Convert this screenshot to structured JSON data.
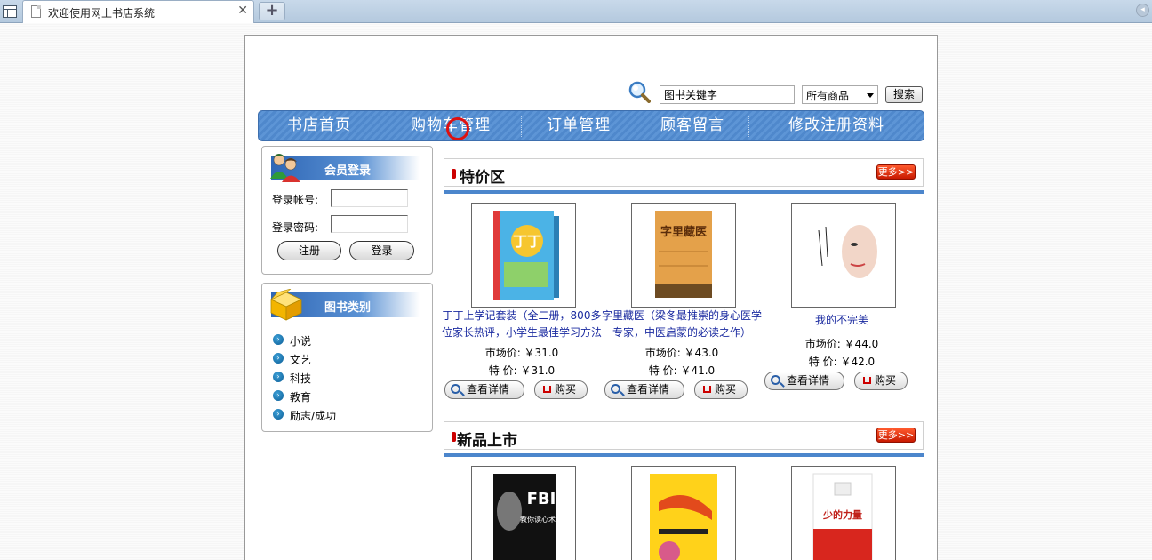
{
  "browser": {
    "tab_title": "欢迎使用网上书店系统",
    "close_glyph": "✕",
    "new_tab_glyph": "+"
  },
  "search": {
    "input_value": "图书关键字",
    "select_value": "所有商品",
    "button_label": "搜索"
  },
  "nav": {
    "items": [
      "书店首页",
      "购物车管理",
      "订单管理",
      "顾客留言",
      "修改注册资料"
    ]
  },
  "login": {
    "title": "会员登录",
    "account_label": "登录帐号:",
    "password_label": "登录密码:",
    "register_label": "注册",
    "login_label": "登录"
  },
  "categories": {
    "title": "图书类别",
    "items": [
      "小说",
      "文艺",
      "科技",
      "教育",
      "励志/成功"
    ]
  },
  "specials": {
    "title": "特价区",
    "more_label": "更多>>",
    "products": [
      {
        "name_line1": "丁丁上学记套装（全二册，800多",
        "name_line2": "位家长热评，小学生最佳学习方法",
        "market_price": "市场价: ￥31.0",
        "special_price": "特 价: ￥31.0",
        "detail_label": "查看详情",
        "buy_label": "购买"
      },
      {
        "name_line1": "字里藏医（梁冬最推崇的身心医学",
        "name_line2": "专家，中医启蒙的必读之作）",
        "market_price": "市场价: ￥43.0",
        "special_price": "特 价: ￥41.0",
        "detail_label": "查看详情",
        "buy_label": "购买"
      },
      {
        "name_line1": "我的不完美",
        "name_line2": "",
        "market_price": "市场价: ￥44.0",
        "special_price": "特 价: ￥42.0",
        "detail_label": "查看详情",
        "buy_label": "购买"
      }
    ]
  },
  "new_arrivals": {
    "title": "新品上市",
    "more_label": "更多>>"
  },
  "book_covers": {
    "dingding_title": "丁丁",
    "ziliyi_title": "字里藏医",
    "fbi_text": "FBI",
    "fbi_sub": "教你读心术",
    "shaode_title": "少的力量"
  },
  "colors": {
    "nav_blue": "#4f88cc",
    "link_blue": "#1b2ba0",
    "more_red": "#c81a00"
  }
}
